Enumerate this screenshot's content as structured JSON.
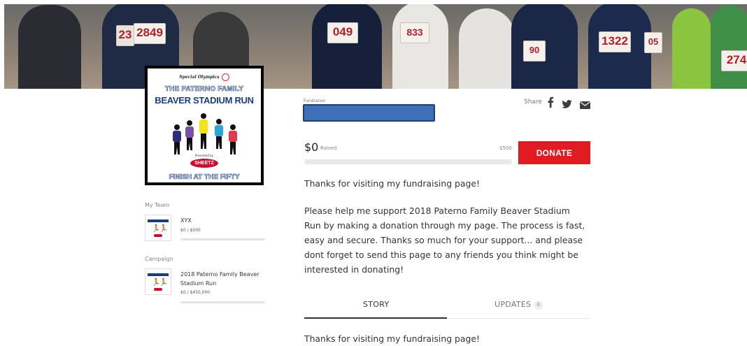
{
  "poster": {
    "org_label": "Special Olympics",
    "title_line1": "THE PATERNO FAMILY",
    "title_line2": "BEAVER STADIUM RUN",
    "powered_by": "Presented by",
    "sponsor": "SHEETZ",
    "tagline": "FINISH AT THE FIFTY"
  },
  "bibs": [
    "23",
    "2849",
    "049",
    "833",
    "90",
    "1322",
    "05",
    "274"
  ],
  "sidebar": {
    "team_label": "My Team",
    "team": {
      "name": "XYX",
      "amount": "$0 / $500",
      "progress": 0
    },
    "campaign_label": "Campaign",
    "campaign": {
      "name_line1": "2018 Paterno Family Beaver",
      "name_line2": "Stadium Run",
      "amount": "$0 / $450,000",
      "progress": 0
    }
  },
  "fundraiser": {
    "label": "Fundraiser",
    "share_label": "Share",
    "raised_amount": "$0",
    "raised_label": "Raised",
    "goal": "$500",
    "progress": 0,
    "donate_label": "DONATE"
  },
  "message": {
    "intro": "Thanks for visiting my fundraising page!",
    "body_lines": [
      "Please help me support 2018 Paterno Family Beaver Stadium",
      "Run by making a donation through my page. The process is fast,",
      "easy and secure. Thanks so much for your support... and please",
      "dont forget to send this page to any friends you think might be",
      "interested in donating!"
    ]
  },
  "tabs": [
    {
      "label": "STORY",
      "active": true
    },
    {
      "label": "UPDATES",
      "count": "0",
      "active": false
    }
  ],
  "story_intro": "Thanks for visiting my fundraising page!",
  "colors": {
    "accent": "#e01b22",
    "brand_blue": "#1c3c82"
  }
}
